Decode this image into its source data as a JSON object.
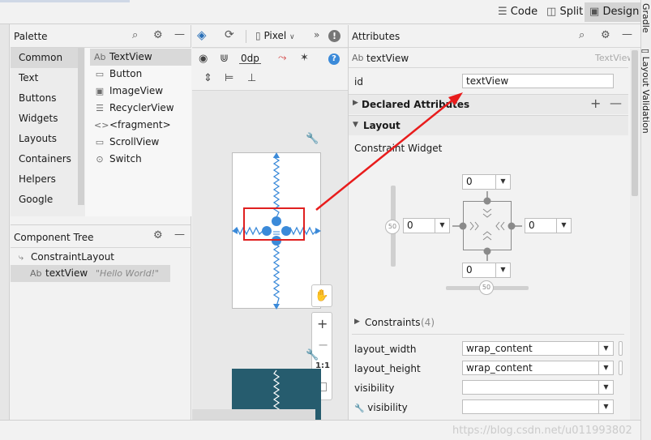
{
  "view_modes": {
    "code": "Code",
    "split": "Split",
    "design": "Design"
  },
  "palette": {
    "title": "Palette",
    "categories": [
      "Common",
      "Text",
      "Buttons",
      "Widgets",
      "Layouts",
      "Containers",
      "Helpers",
      "Google"
    ],
    "items": [
      {
        "icon": "Ab",
        "label": "TextView"
      },
      {
        "icon": "▭",
        "label": "Button"
      },
      {
        "icon": "▣",
        "label": "ImageView"
      },
      {
        "icon": "☰",
        "label": "RecyclerView"
      },
      {
        "icon": "<>",
        "label": "<fragment>"
      },
      {
        "icon": "▭",
        "label": "ScrollView"
      },
      {
        "icon": "⊙",
        "label": "Switch"
      }
    ]
  },
  "component_tree": {
    "title": "Component Tree",
    "root": "ConstraintLayout",
    "child_icon": "Ab",
    "child": "textView",
    "child_text": "\"Hello World!\""
  },
  "toolbar": {
    "device": "Pixel",
    "margin": "0dp"
  },
  "zoom": {
    "plus": "+",
    "minus": "−",
    "ratio": "1:1"
  },
  "attributes": {
    "title": "Attributes",
    "component_icon": "Ab",
    "component": "textView",
    "component_type": "TextView",
    "id_label": "id",
    "id_value": "textView",
    "declared": "Declared Attributes",
    "layout": "Layout",
    "constraint_widget": "Constraint Widget",
    "margin_top": "0",
    "margin_left": "0",
    "margin_right": "0",
    "margin_bottom": "0",
    "bias_v": "50",
    "bias_h": "50",
    "constraints": "Constraints",
    "constraints_count": "(4)",
    "rows": [
      {
        "label": "layout_width",
        "value": "wrap_content"
      },
      {
        "label": "layout_height",
        "value": "wrap_content"
      },
      {
        "label": "visibility",
        "value": ""
      },
      {
        "label": "visibility",
        "value": ""
      }
    ]
  },
  "gutter": {
    "gradle": "Gradle",
    "validation": "Layout Validation"
  },
  "watermark": "https://blog.csdn.net/u011993802"
}
